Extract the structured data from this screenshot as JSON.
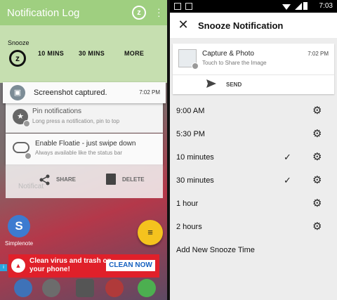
{
  "left": {
    "app_title": "Notification Log",
    "snooze": {
      "label": "Snooze",
      "options": [
        "10 MINS",
        "30 MINS",
        "MORE"
      ]
    },
    "notifications": [
      {
        "title": "Screenshot captured.",
        "time": "7:02 PM",
        "icon": "image-icon"
      },
      {
        "title": "Pin notifications",
        "subtitle": "Long press a notification, pin to top",
        "icon": "star-icon"
      },
      {
        "title": "Enable Floatie - just swipe down",
        "subtitle": "Always available like the status bar",
        "icon": "cloud-icon"
      }
    ],
    "actions": {
      "share": "SHARE",
      "delete": "DELETE",
      "ghost": "Notificat"
    },
    "home_app": {
      "name": "Simplenote",
      "glyph": "S"
    },
    "ad": {
      "text": "Clean virus and trash on your phone!",
      "cta": "CLEAN NOW",
      "info": "i"
    },
    "fab_glyph": "≡",
    "colors": {
      "toolbar": "#9fcf80",
      "snooze_bar": "#c6dfb0",
      "fab": "#f4c31e",
      "ad": "#e0202a"
    }
  },
  "right": {
    "status_time": "7:03",
    "title": "Snooze Notification",
    "close_glyph": "✕",
    "card": {
      "title": "Capture & Photo",
      "subtitle": "Touch to Share the Image",
      "time": "7:02 PM",
      "send": "SEND"
    },
    "options": [
      {
        "label": "9:00 AM",
        "checked": false
      },
      {
        "label": "5:30 PM",
        "checked": false
      },
      {
        "label": "10 minutes",
        "checked": true
      },
      {
        "label": "30 minutes",
        "checked": true
      },
      {
        "label": "1 hour",
        "checked": false
      },
      {
        "label": "2 hours",
        "checked": false
      }
    ],
    "add_label": "Add New Snooze Time",
    "check_glyph": "✓",
    "gear_glyph": "⚙"
  }
}
